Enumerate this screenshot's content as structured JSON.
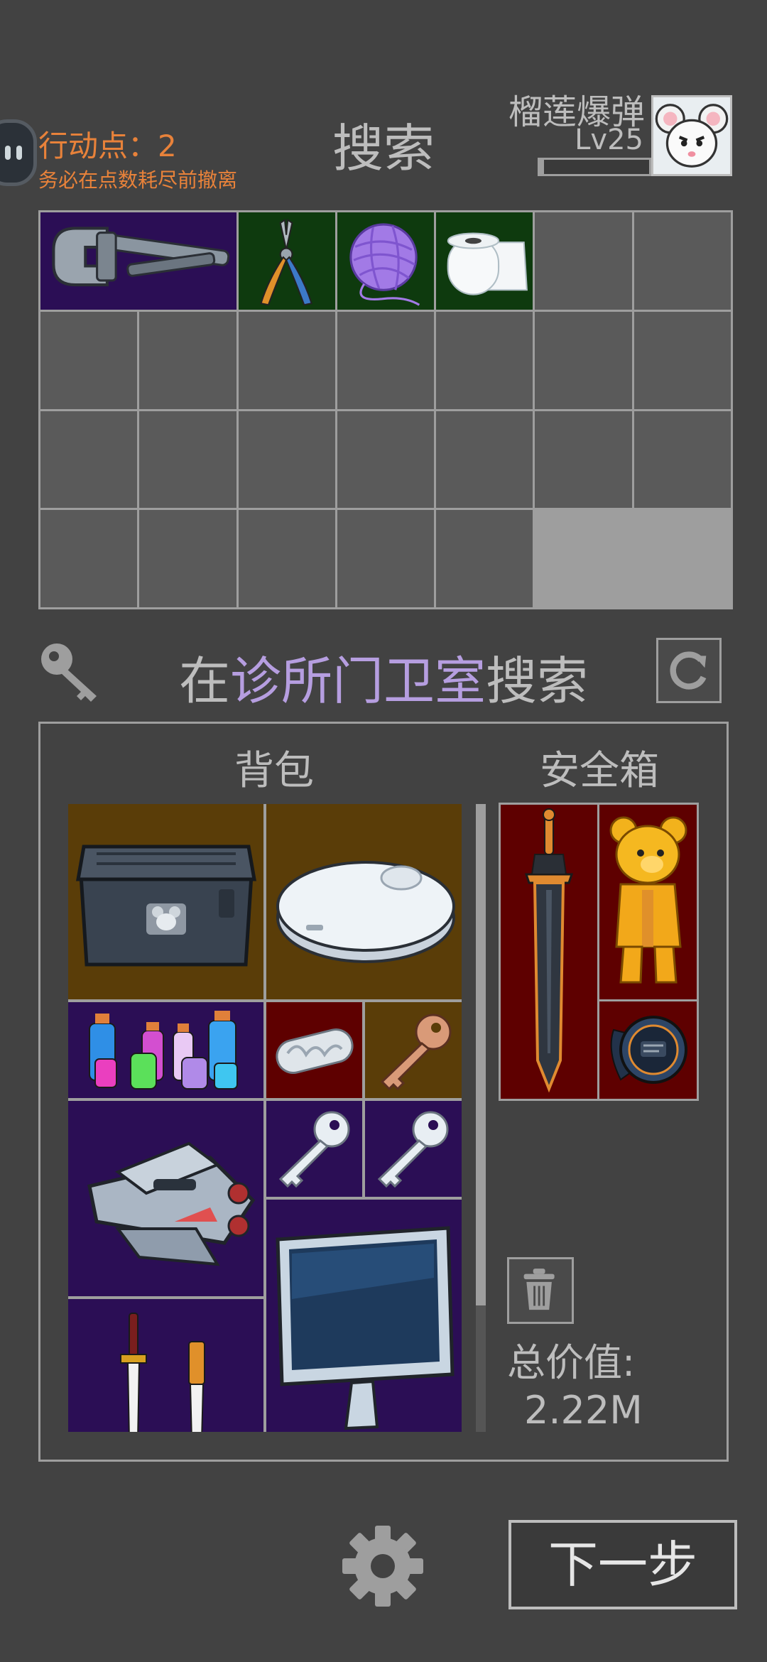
{
  "header": {
    "action_points_label": "行动点：",
    "action_points_value": "2",
    "hint": "务必在点数耗尽前撤离",
    "title": "搜索",
    "player_name": "榴莲爆弹",
    "player_level": "Lv25",
    "xp_fraction": 0.04
  },
  "loot": {
    "columns": 7,
    "rows": 4,
    "items": [
      {
        "name": "pipe-wrench",
        "icon": "wrench-icon",
        "rarity_color": "#2b0e55"
      },
      {
        "name": "pliers",
        "icon": "pliers-icon",
        "rarity_color": "#0e3a0e"
      },
      {
        "name": "yarn-ball",
        "icon": "yarn-icon",
        "rarity_color": "#0e3a0e"
      },
      {
        "name": "toilet-paper",
        "icon": "toilet-paper-icon",
        "rarity_color": "#0e3a0e"
      }
    ]
  },
  "search": {
    "prefix": "在",
    "location": "诊所门卫室",
    "suffix": "搜索"
  },
  "inventory": {
    "backpack_label": "背包",
    "safebox_label": "安全箱",
    "backpack_items": [
      "case-icon",
      "robot-vacuum-icon",
      "potion-bottles-icon",
      "pill-capsule-icon",
      "copper-key-icon",
      "spaceship-icon",
      "silver-key-icon",
      "silver-key-icon",
      "monitor-icon",
      "knives-icon"
    ],
    "safebox_items": [
      "sword-icon",
      "golden-bear-icon",
      "watch-icon"
    ],
    "total_value_label": "总价值:",
    "total_value": "2.22M"
  },
  "footer": {
    "next_label": "下一步"
  },
  "colors": {
    "background": "#424242",
    "accent_orange": "#e8823a",
    "location_purple": "#b69ee0",
    "rarity_purple": "#2b0e55",
    "rarity_green": "#0e3a0e",
    "rarity_brown": "#5a3d08",
    "rarity_red": "#5e0000"
  }
}
